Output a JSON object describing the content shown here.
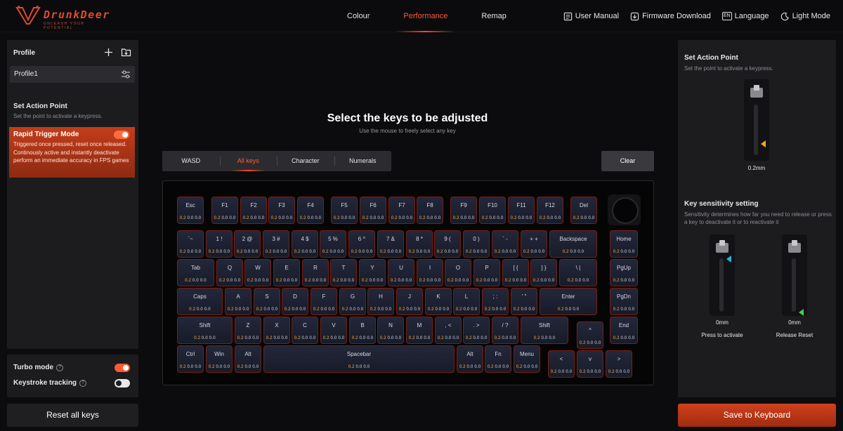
{
  "app": {
    "brand": "DrunkDeer",
    "tagline": "UNLEASH YOUR POTENTIAL"
  },
  "nav": {
    "tabs": [
      {
        "label": "Colour",
        "active": false
      },
      {
        "label": "Performance",
        "active": true
      },
      {
        "label": "Remap",
        "active": false
      }
    ]
  },
  "header": {
    "user_manual": "User Manual",
    "firmware": "Firmware Download",
    "language": "Language",
    "language_badge": "EN",
    "theme": "Light Mode"
  },
  "left": {
    "profile_title": "Profile",
    "profile_name": "Profile1",
    "section_title": "Set Action Point",
    "section_desc": "Set the point to activate a keypress.",
    "rapid_title": "Rapid Trigger Mode",
    "rapid_desc": "Triggered once pressed, reset once released. Continously active and instantly deactivate perform an immediate accuracy in FPS games",
    "rapid_on": true,
    "turbo_label": "Turbo mode",
    "turbo_on": true,
    "tracking_label": "Keystroke tracking",
    "tracking_on": false,
    "reset_label": "Reset all keys"
  },
  "center": {
    "title": "Select the keys to be adjusted",
    "subtitle": "Use the mouse to freely select any key",
    "filters": [
      {
        "label": "WASD",
        "active": false
      },
      {
        "label": "All keys",
        "active": true
      },
      {
        "label": "Character",
        "active": false
      },
      {
        "label": "Numerals",
        "active": false
      }
    ],
    "clear_label": "Clear"
  },
  "keyboard": {
    "value_text": {
      "action": "0.2",
      "rest": "0.0 0.0"
    },
    "keys": [
      {
        "label": "Esc"
      },
      {
        "label": "F1"
      },
      {
        "label": "F2"
      },
      {
        "label": "F3"
      },
      {
        "label": "F4"
      },
      {
        "label": "F5"
      },
      {
        "label": "F6"
      },
      {
        "label": "F7"
      },
      {
        "label": "F8"
      },
      {
        "label": "F9"
      },
      {
        "label": "F10"
      },
      {
        "label": "F11"
      },
      {
        "label": "F12"
      },
      {
        "label": "Del"
      },
      {
        "label": "`~"
      },
      {
        "label": "1 !"
      },
      {
        "label": "2 @"
      },
      {
        "label": "3 #"
      },
      {
        "label": "4 $"
      },
      {
        "label": "5 %"
      },
      {
        "label": "6 ^"
      },
      {
        "label": "7 &"
      },
      {
        "label": "8 *"
      },
      {
        "label": "9 ("
      },
      {
        "label": "0 )"
      },
      {
        "label": "` -"
      },
      {
        "label": "+ +"
      },
      {
        "label": "Backspace"
      },
      {
        "label": "Home"
      },
      {
        "label": "Tab"
      },
      {
        "label": "Q"
      },
      {
        "label": "W"
      },
      {
        "label": "E"
      },
      {
        "label": "R"
      },
      {
        "label": "T"
      },
      {
        "label": "Y"
      },
      {
        "label": "U"
      },
      {
        "label": "I"
      },
      {
        "label": "O"
      },
      {
        "label": "P"
      },
      {
        "label": "[ {"
      },
      {
        "label": "] }"
      },
      {
        "label": "\\ |"
      },
      {
        "label": "PgUp"
      },
      {
        "label": "Caps"
      },
      {
        "label": "A"
      },
      {
        "label": "S"
      },
      {
        "label": "D"
      },
      {
        "label": "F"
      },
      {
        "label": "G"
      },
      {
        "label": "H"
      },
      {
        "label": "J"
      },
      {
        "label": "K"
      },
      {
        "label": "L"
      },
      {
        "label": "; :"
      },
      {
        "label": "' \""
      },
      {
        "label": "Enter"
      },
      {
        "label": "PgDn"
      },
      {
        "label": "Shift"
      },
      {
        "label": "Z"
      },
      {
        "label": "X"
      },
      {
        "label": "C"
      },
      {
        "label": "V"
      },
      {
        "label": "B"
      },
      {
        "label": "N"
      },
      {
        "label": "M"
      },
      {
        "label": ", <"
      },
      {
        "label": ". >"
      },
      {
        "label": "/ ?"
      },
      {
        "label": "Shift"
      },
      {
        "label": "^"
      },
      {
        "label": "End"
      },
      {
        "label": "Ctrl"
      },
      {
        "label": "Win"
      },
      {
        "label": "Alt"
      },
      {
        "label": "Spacebar"
      },
      {
        "label": "Alt"
      },
      {
        "label": "Fn"
      },
      {
        "label": "Menu"
      },
      {
        "label": "<"
      },
      {
        "label": "v"
      },
      {
        "label": ">"
      }
    ]
  },
  "right": {
    "action_title": "Set Action Point",
    "action_desc": "Set the point to activate a keypress.",
    "action_value": "0.2mm",
    "sens_title": "Key sensitivity setting",
    "sens_desc": "Sensitivity determines how far you need to release or press a key to deactivate it or to reactivate it",
    "press_value": "0mm",
    "press_label": "Press to activate",
    "release_value": "0mm",
    "release_label": "Release Reset",
    "save_label": "Save to Keyboard"
  },
  "colors": {
    "accent": "#ff5a36",
    "marker_orange": "#ffa41c",
    "marker_cyan": "#27b3d9",
    "marker_green": "#3fd14a"
  }
}
